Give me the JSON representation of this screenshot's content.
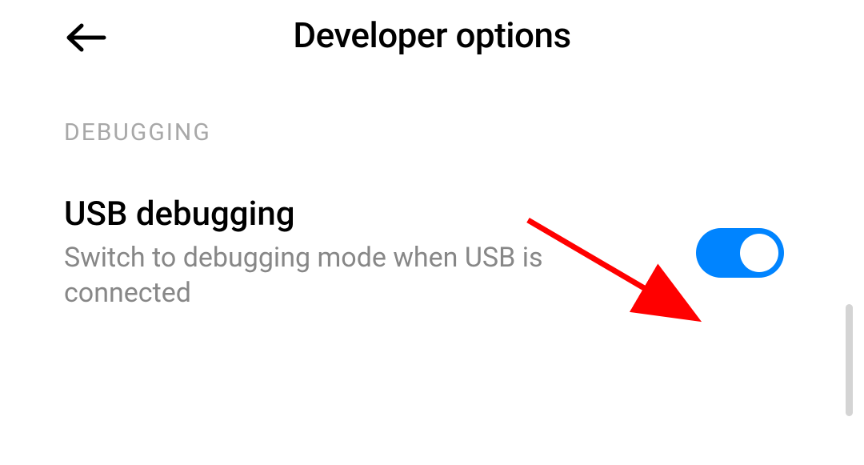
{
  "header": {
    "title": "Developer options"
  },
  "section": {
    "label": "DEBUGGING"
  },
  "setting": {
    "title": "USB debugging",
    "description": "Switch to debugging mode when USB is connected",
    "enabled": true
  },
  "colors": {
    "toggle_on": "#0084ff",
    "arrow_annotation": "#ff0000"
  }
}
